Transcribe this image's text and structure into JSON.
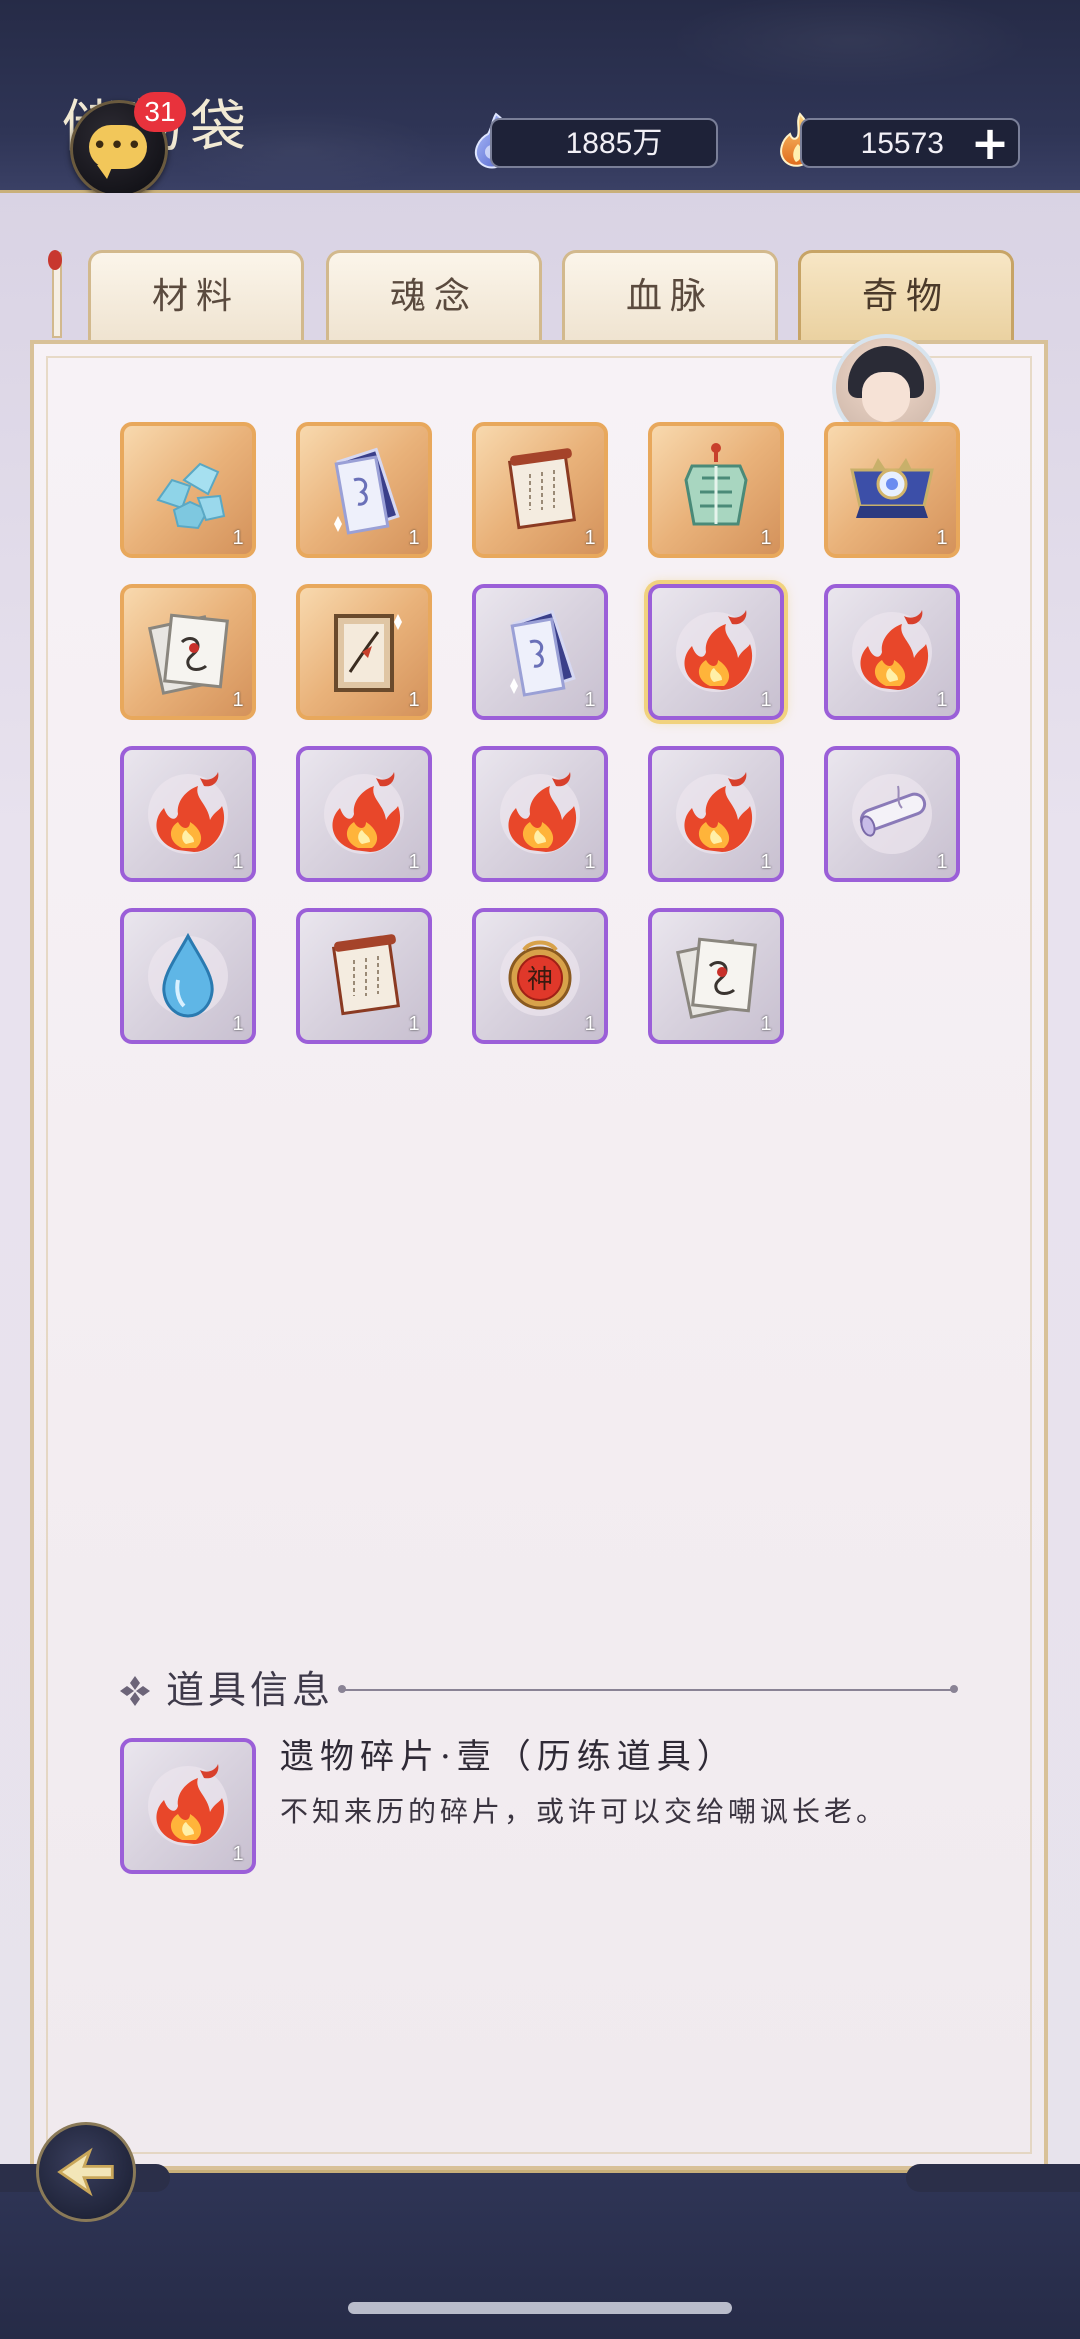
{
  "header": {
    "title": "储物袋",
    "chat_badge_count": "31",
    "resources": [
      {
        "icon": "soul-crystal-icon",
        "value": "1885万"
      },
      {
        "icon": "flame-coin-icon",
        "value": "15573",
        "add_label": "+"
      }
    ]
  },
  "tabs": [
    {
      "label": "材料",
      "active": false
    },
    {
      "label": "魂念",
      "active": false
    },
    {
      "label": "血脉",
      "active": false
    },
    {
      "label": "奇物",
      "active": true
    }
  ],
  "items": [
    {
      "icon": "blue-stones-icon",
      "rarity": "gold",
      "qty": "1"
    },
    {
      "icon": "talisman-paper-icon",
      "rarity": "gold",
      "qty": "1"
    },
    {
      "icon": "scroll-icon",
      "rarity": "gold",
      "qty": "1"
    },
    {
      "icon": "jade-armor-icon",
      "rarity": "gold",
      "qty": "1"
    },
    {
      "icon": "emblem-chest-icon",
      "rarity": "gold",
      "qty": "1"
    },
    {
      "icon": "sealed-letter-icon",
      "rarity": "gold",
      "qty": "1"
    },
    {
      "icon": "painting-frame-icon",
      "rarity": "gold",
      "qty": "1"
    },
    {
      "icon": "talisman-paper-icon",
      "rarity": "purple",
      "qty": "1"
    },
    {
      "icon": "flame-fragment-icon",
      "rarity": "purple",
      "qty": "1",
      "selected": true
    },
    {
      "icon": "flame-fragment-icon",
      "rarity": "purple",
      "qty": "1"
    },
    {
      "icon": "flame-fragment-icon",
      "rarity": "purple",
      "qty": "1"
    },
    {
      "icon": "flame-fragment-icon",
      "rarity": "purple",
      "qty": "1"
    },
    {
      "icon": "flame-fragment-icon",
      "rarity": "purple",
      "qty": "1"
    },
    {
      "icon": "flame-fragment-icon",
      "rarity": "purple",
      "qty": "1"
    },
    {
      "icon": "rolled-scroll-icon",
      "rarity": "purple",
      "qty": "1"
    },
    {
      "icon": "water-drop-icon",
      "rarity": "purple",
      "qty": "1"
    },
    {
      "icon": "scroll-icon",
      "rarity": "purple",
      "qty": "1"
    },
    {
      "icon": "divine-seal-icon",
      "rarity": "purple",
      "qty": "1",
      "seal_text": "神"
    },
    {
      "icon": "sealed-letter-icon",
      "rarity": "purple",
      "qty": "1"
    }
  ],
  "info": {
    "heading": "道具信息",
    "item_name": "遗物碎片·壹（历练道具）",
    "item_desc": "不知来历的碎片，或许可以交给嘲讽长老。",
    "item_icon": "flame-fragment-icon",
    "item_qty": "1"
  },
  "colors": {
    "gold_frame": "#e8a85c",
    "purple_frame": "#9b5fd8",
    "header_bg": "#2f3556",
    "badge": "#e8323c"
  }
}
